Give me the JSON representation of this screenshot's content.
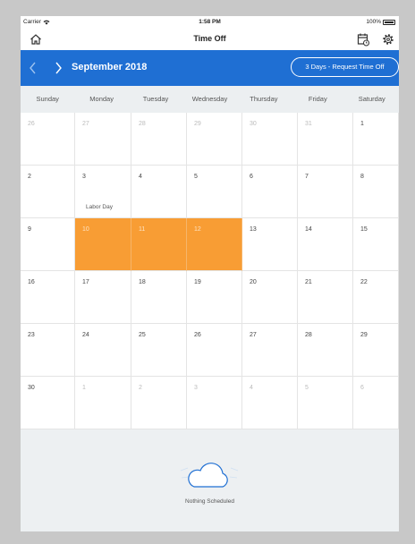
{
  "status_bar": {
    "carrier": "Carrier",
    "time": "1:58 PM",
    "battery": "100%"
  },
  "header": {
    "title": "Time Off",
    "icons": [
      "home-icon",
      "calendar-icon",
      "gear-icon"
    ]
  },
  "nav": {
    "month": "September 2018",
    "request_button": "3 Days - Request Time Off"
  },
  "weekdays": [
    "Sunday",
    "Monday",
    "Tuesday",
    "Wednesday",
    "Thursday",
    "Friday",
    "Saturday"
  ],
  "weeks": [
    [
      {
        "d": "26",
        "o": true
      },
      {
        "d": "27",
        "o": true
      },
      {
        "d": "28",
        "o": true
      },
      {
        "d": "29",
        "o": true
      },
      {
        "d": "30",
        "o": true
      },
      {
        "d": "31",
        "o": true
      },
      {
        "d": "1"
      }
    ],
    [
      {
        "d": "2"
      },
      {
        "d": "3",
        "note": "Labor Day"
      },
      {
        "d": "4"
      },
      {
        "d": "5"
      },
      {
        "d": "6"
      },
      {
        "d": "7"
      },
      {
        "d": "8"
      }
    ],
    [
      {
        "d": "9"
      },
      {
        "d": "10",
        "sel": true
      },
      {
        "d": "11",
        "sel": true
      },
      {
        "d": "12",
        "sel": true
      },
      {
        "d": "13"
      },
      {
        "d": "14"
      },
      {
        "d": "15"
      }
    ],
    [
      {
        "d": "16"
      },
      {
        "d": "17"
      },
      {
        "d": "18"
      },
      {
        "d": "19"
      },
      {
        "d": "20"
      },
      {
        "d": "21"
      },
      {
        "d": "22"
      }
    ],
    [
      {
        "d": "23"
      },
      {
        "d": "24"
      },
      {
        "d": "25"
      },
      {
        "d": "26"
      },
      {
        "d": "27"
      },
      {
        "d": "28"
      },
      {
        "d": "29"
      }
    ],
    [
      {
        "d": "30"
      },
      {
        "d": "1",
        "o": true
      },
      {
        "d": "2",
        "o": true
      },
      {
        "d": "3",
        "o": true
      },
      {
        "d": "4",
        "o": true
      },
      {
        "d": "5",
        "o": true
      },
      {
        "d": "6",
        "o": true
      }
    ]
  ],
  "empty_state": {
    "message": "Nothing Scheduled"
  },
  "colors": {
    "accent": "#1f6fd3",
    "selected": "#f89d34"
  }
}
